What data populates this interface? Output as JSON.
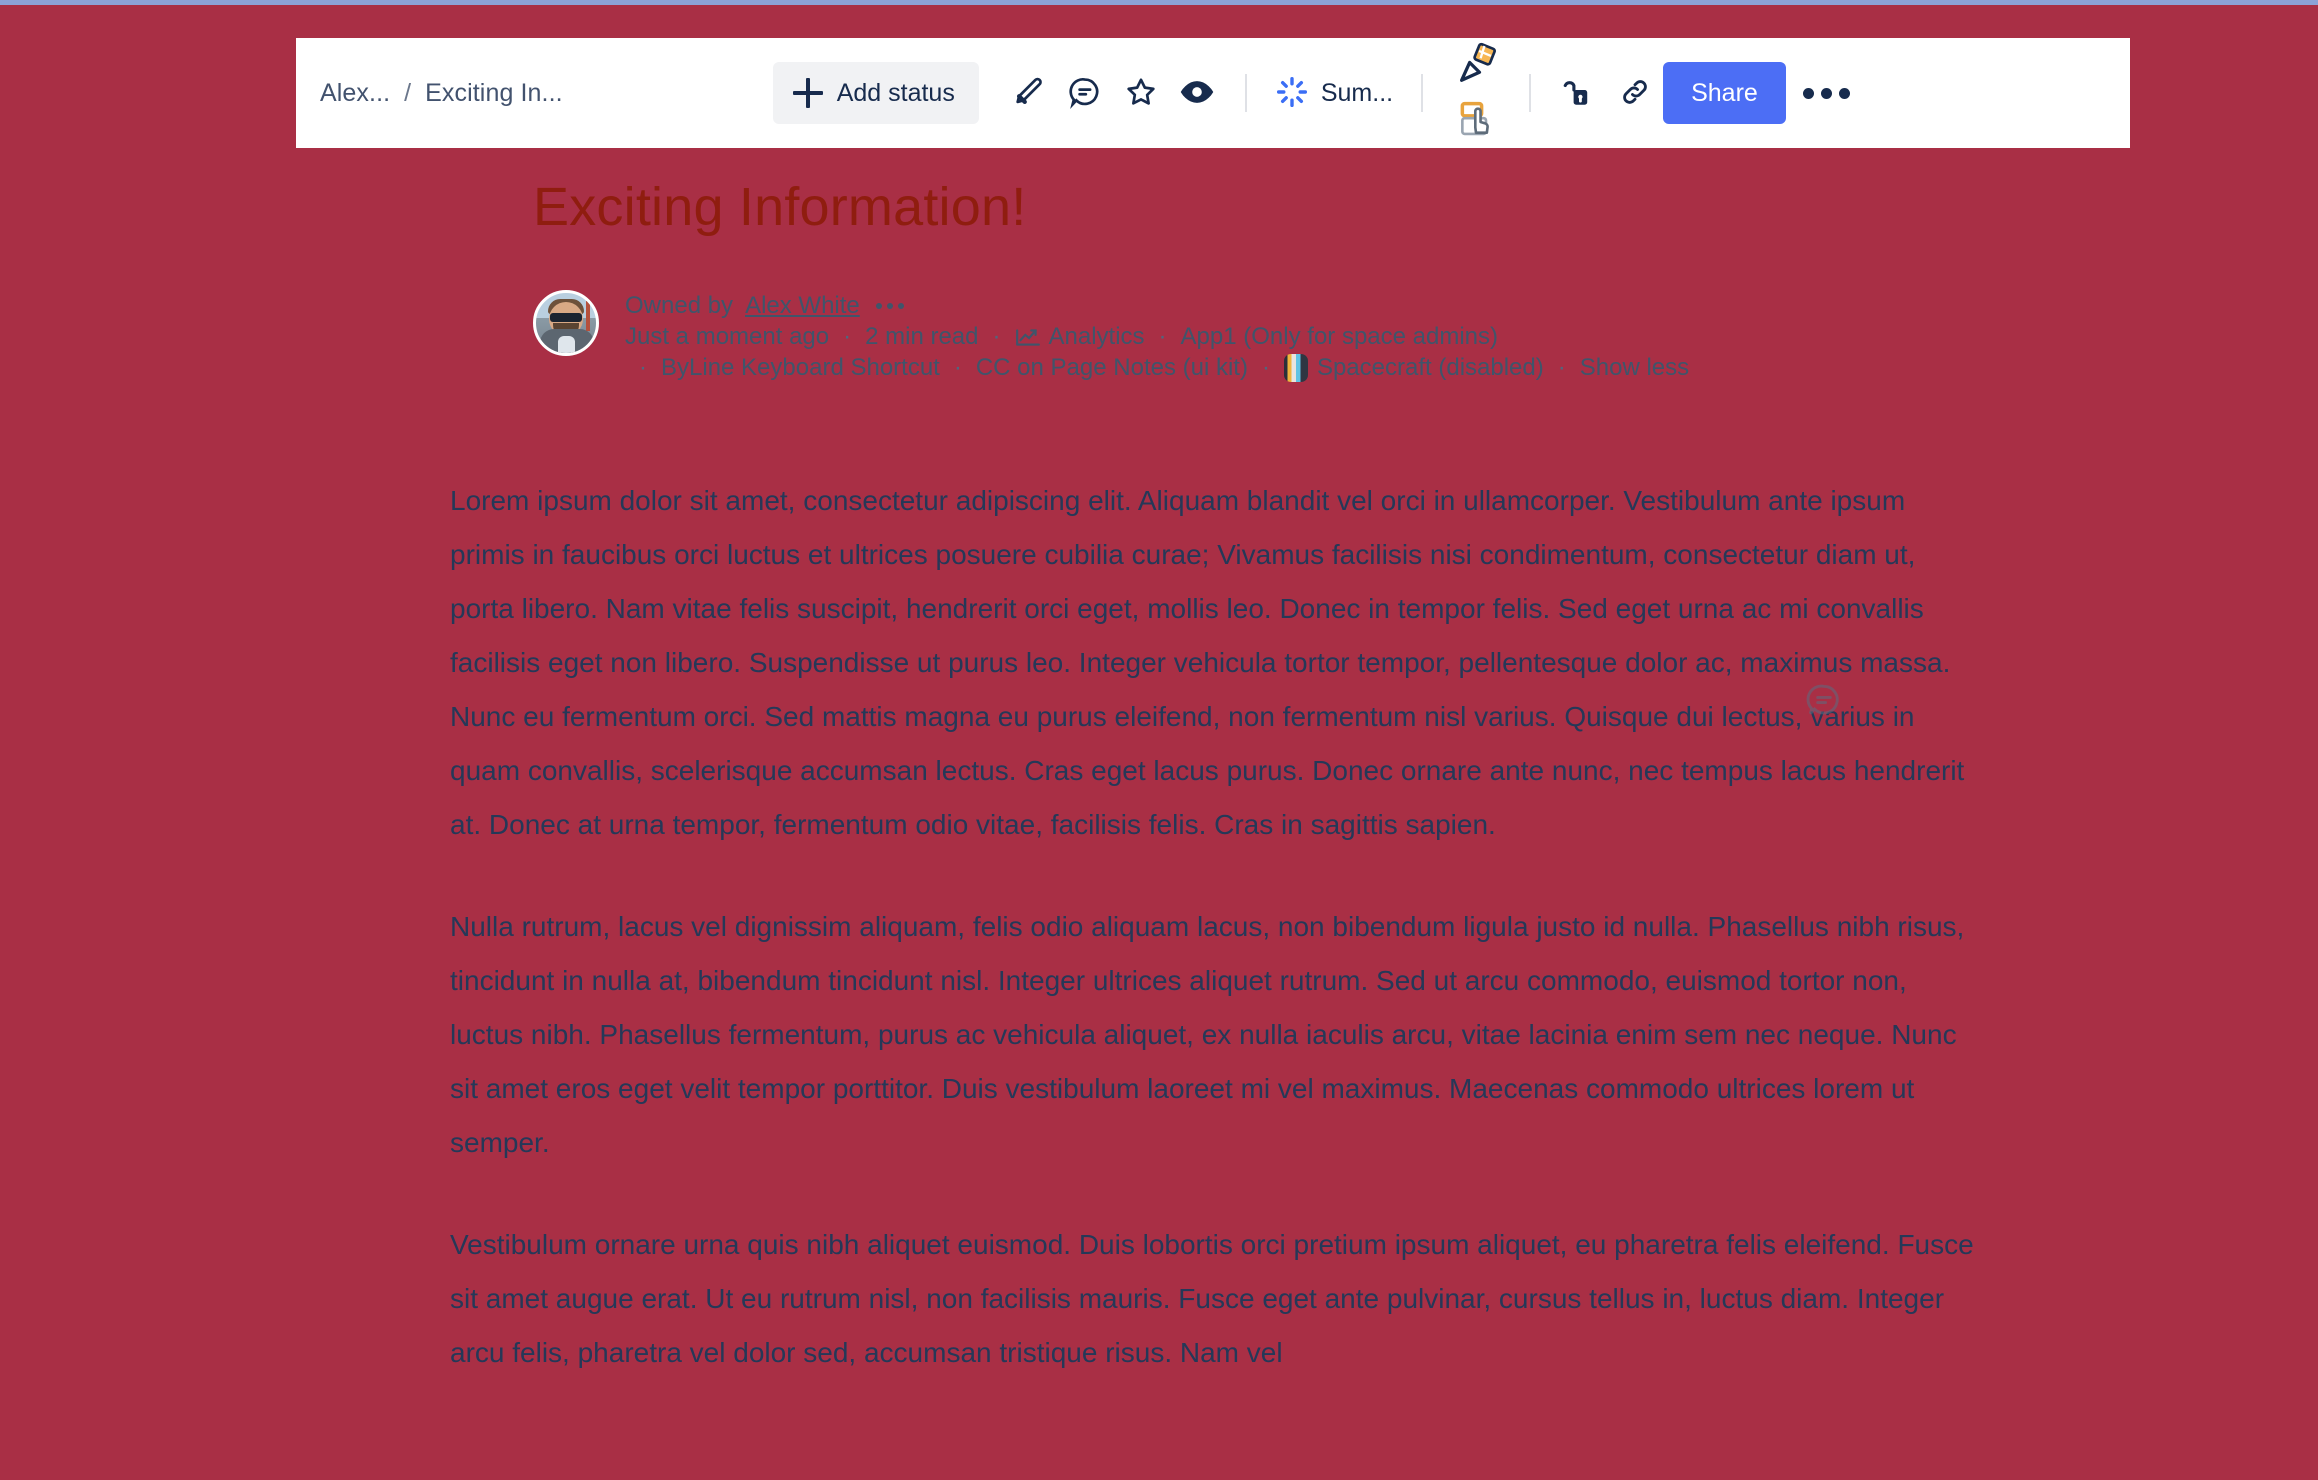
{
  "colors": {
    "page_background": "#a92f45",
    "toolbar_background": "#ffffff",
    "title_text": "#8f1d0f",
    "body_text": "#253858",
    "share_button": "#4c6ef5",
    "top_strip": "#8ca2d6"
  },
  "toolbar": {
    "breadcrumbs": [
      {
        "label": "Alex..."
      },
      {
        "label": "Exciting In..."
      }
    ],
    "breadcrumb_separator": "/",
    "add_status_label": "Add status",
    "icons": [
      {
        "name": "edit-icon"
      },
      {
        "name": "comment-icon"
      },
      {
        "name": "star-icon"
      },
      {
        "name": "watch-eye-icon"
      }
    ],
    "ai_button_label": "Sum...",
    "apps": [
      {
        "name": "confetti-flag-icon"
      },
      {
        "name": "click-cursor-icon"
      }
    ],
    "lock_icon": "unlocked-padlock-icon",
    "link_icon": "copy-link-icon",
    "share_label": "Share",
    "more_label": "•••"
  },
  "page": {
    "title": "Exciting Information!",
    "byline": {
      "owned_by_prefix": "Owned by",
      "owner_name": "Alex White",
      "line2": [
        {
          "text": "Just a moment ago",
          "icon": null
        },
        {
          "text": "2 min read",
          "icon": null
        },
        {
          "text": "Analytics",
          "icon": "analytics-chart-icon"
        },
        {
          "text": "App1 (Only for space admins)",
          "icon": null
        }
      ],
      "line3": [
        {
          "text": "ByLine Keyboard Shortcut",
          "icon": null
        },
        {
          "text": "CC on Page Notes (ui kit)",
          "icon": null
        },
        {
          "text": "Spacecraft (disabled)",
          "icon": "spacecraft-badge-icon"
        },
        {
          "text": "Show less",
          "icon": null
        }
      ]
    },
    "paragraphs": [
      "Lorem ipsum dolor sit amet, consectetur adipiscing elit. Aliquam blandit vel orci in ullamcorper. Vestibulum ante ipsum primis in faucibus orci luctus et ultrices posuere cubilia curae; Vivamus facilisis nisi condimentum, consectetur diam ut, porta libero. Nam vitae felis suscipit, hendrerit orci eget, mollis leo. Donec in tempor felis. Sed eget urna ac mi convallis facilisis eget non libero. Suspendisse ut purus leo. Integer vehicula tortor tempor, pellentesque dolor ac, maximus massa. Nunc eu fermentum orci. Sed mattis magna eu purus eleifend, non fermentum nisl varius. Quisque dui lectus, varius in quam convallis, scelerisque accumsan lectus. Cras eget lacus purus. Donec ornare ante nunc, nec tempus lacus hendrerit at. Donec at urna tempor, fermentum odio vitae, facilisis felis. Cras in sagittis sapien.",
      "Nulla rutrum, lacus vel dignissim aliquam, felis odio aliquam lacus, non bibendum ligula justo id nulla. Phasellus nibh risus, tincidunt in nulla at, bibendum tincidunt nisl. Integer ultrices aliquet rutrum. Sed ut arcu commodo, euismod tortor non, luctus nibh. Phasellus fermentum, purus ac vehicula aliquet, ex nulla iaculis arcu, vitae lacinia enim sem nec neque. Nunc sit amet eros eget velit tempor porttitor. Duis vestibulum laoreet mi vel maximus. Maecenas commodo ultrices lorem ut semper.",
      "Vestibulum ornare urna quis nibh aliquet euismod. Duis lobortis orci pretium ipsum aliquet, eu pharetra felis eleifend. Fusce sit amet augue erat. Ut eu rutrum nisl, non facilisis mauris. Fusce eget ante pulvinar, cursus tellus in, luctus diam. Integer arcu felis, pharetra vel dolor sed, accumsan tristique risus. Nam vel"
    ]
  }
}
